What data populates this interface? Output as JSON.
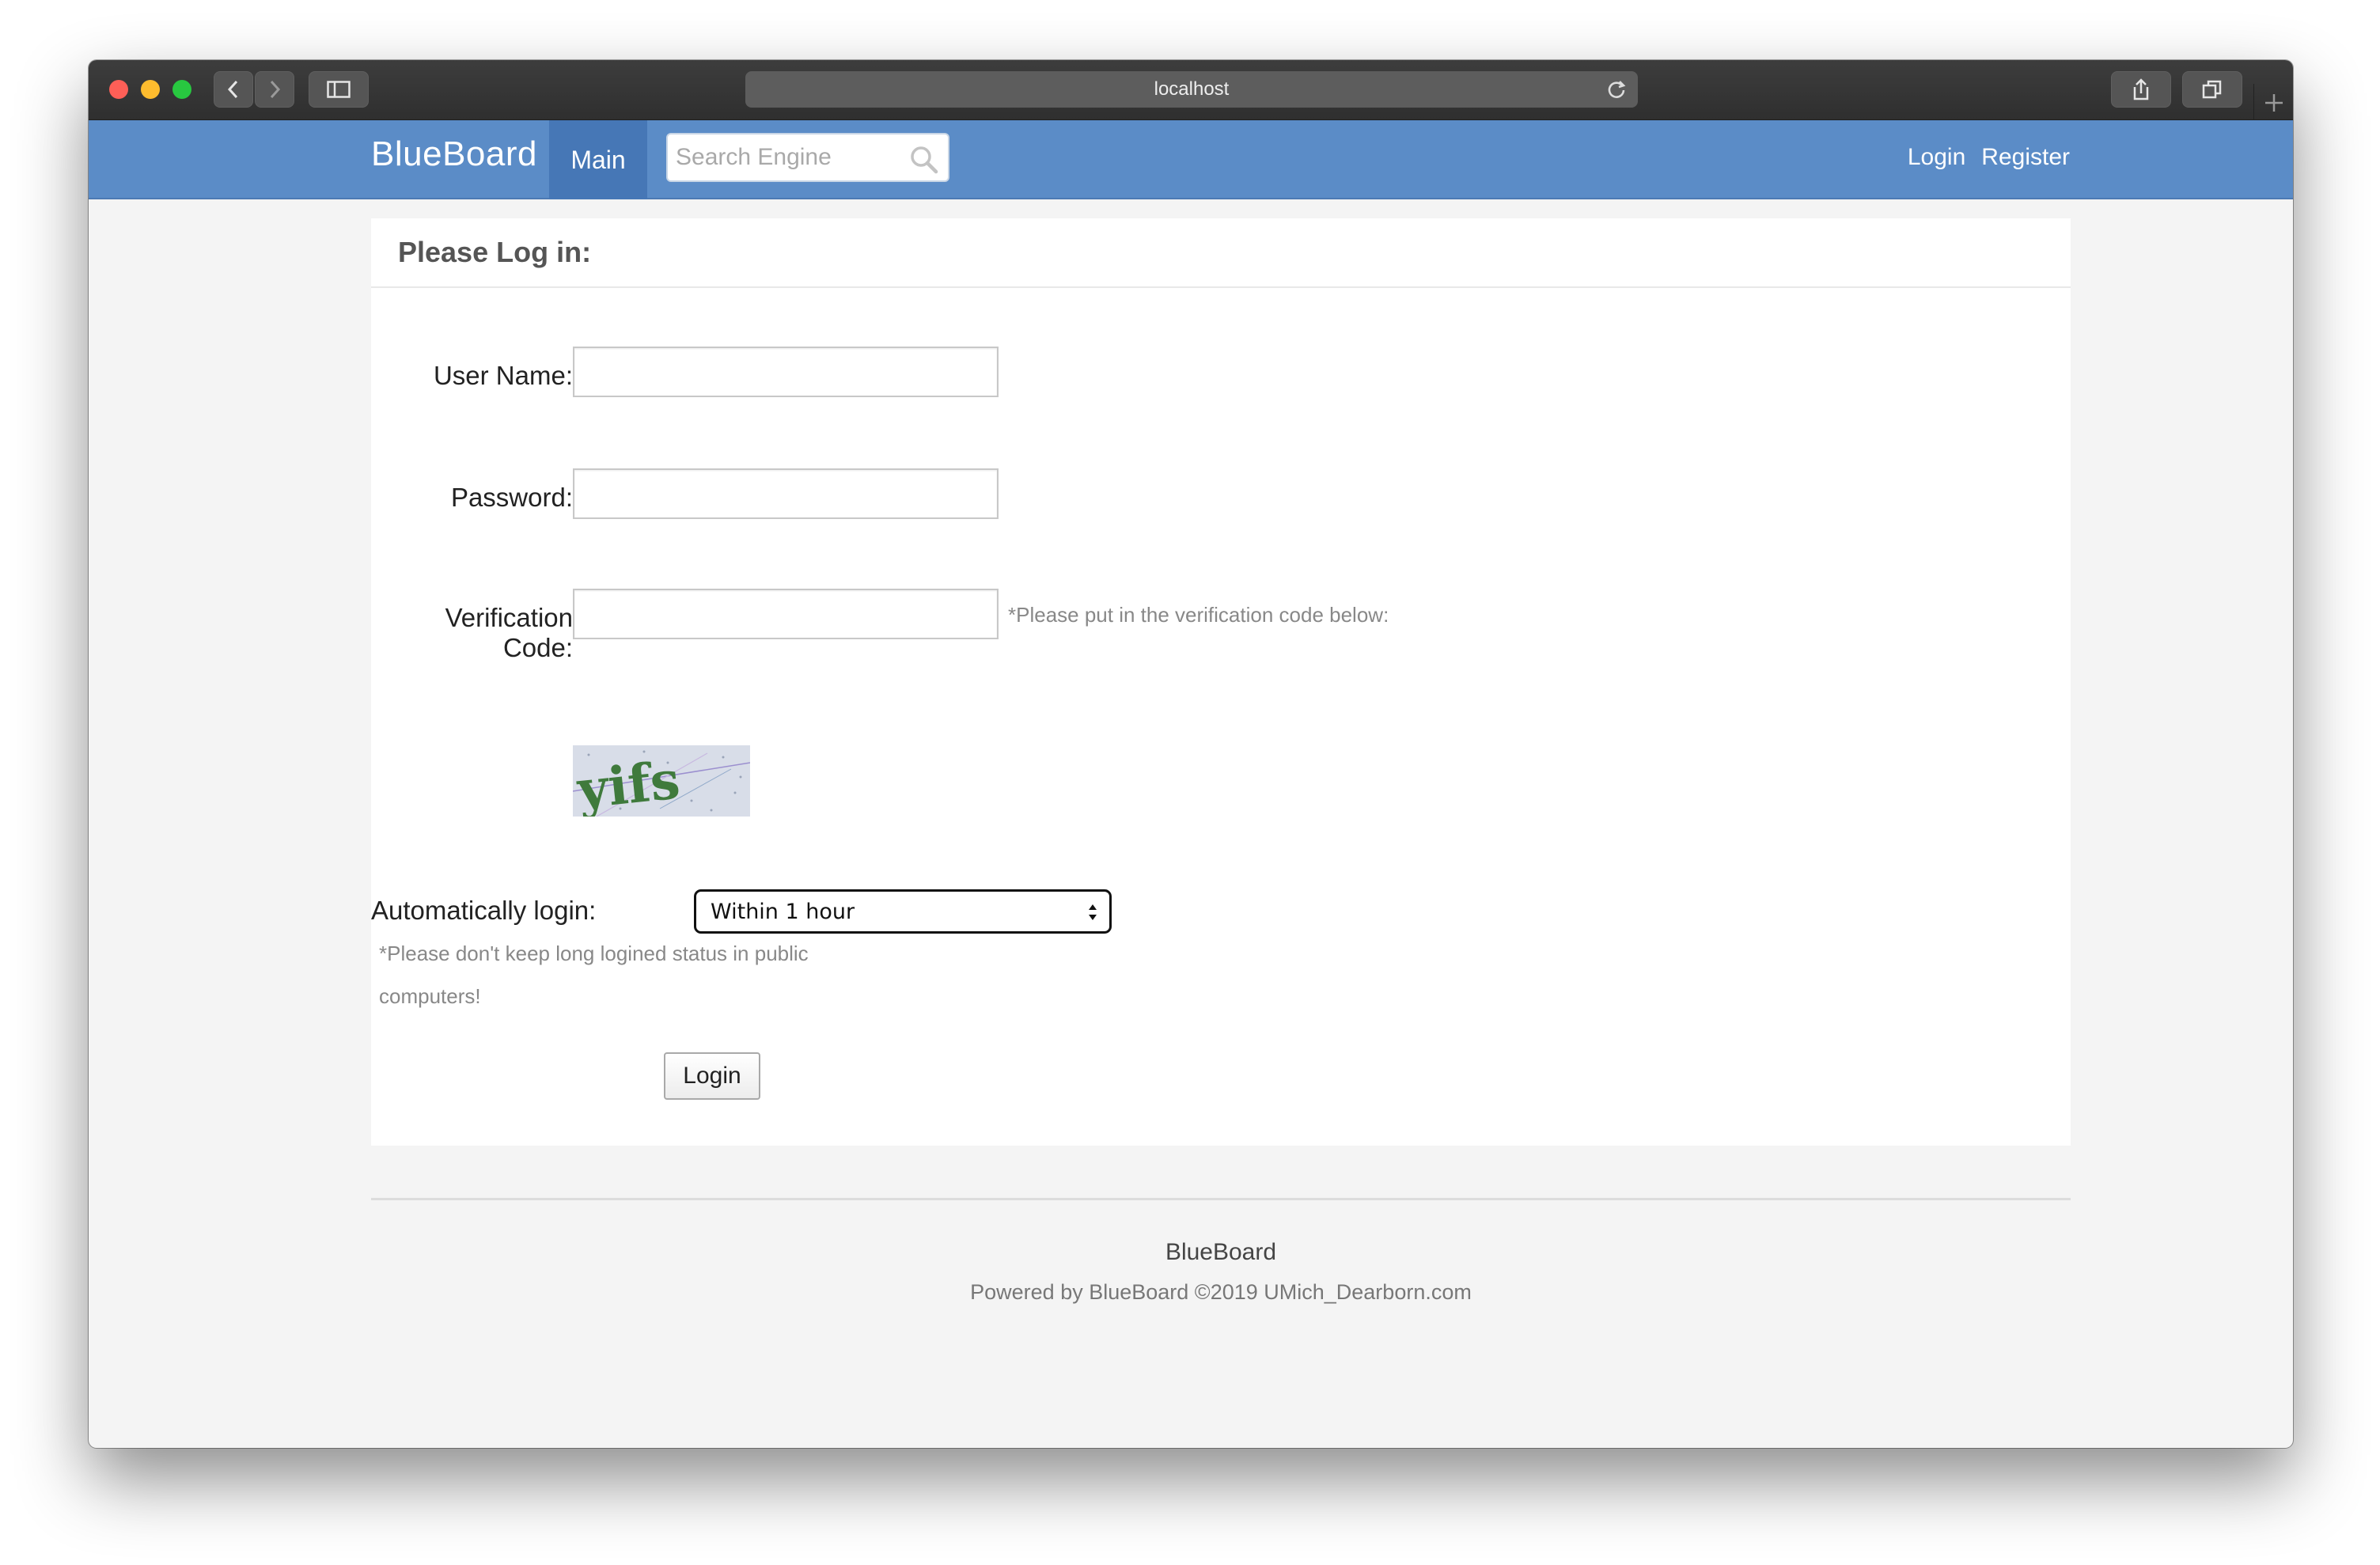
{
  "browser": {
    "address": "localhost"
  },
  "nav": {
    "brand": "BlueBoard",
    "main": "Main",
    "search_placeholder": "Search Engine",
    "login": "Login",
    "register": "Register",
    "accent_color": "#5b8cc7",
    "active_color": "#4677b6"
  },
  "login_panel": {
    "title": "Please Log in:",
    "username_label": "User Name:",
    "username_value": "",
    "password_label": "Password:",
    "password_value": "",
    "verification_label": "Verification Code:",
    "verification_value": "",
    "verification_hint": "*Please put in the verification code below:",
    "captcha_text": "yifs",
    "auto_login_label": "Automatically login:",
    "auto_login_selected": "Within 1 hour",
    "auto_login_hint_line1": "*Please don't keep long logined status in public",
    "auto_login_hint_line2": "computers!",
    "submit_label": "Login"
  },
  "footer": {
    "brand": "BlueBoard",
    "copyright": "Powered by BlueBoard ©2019 UMich_Dearborn.com"
  }
}
